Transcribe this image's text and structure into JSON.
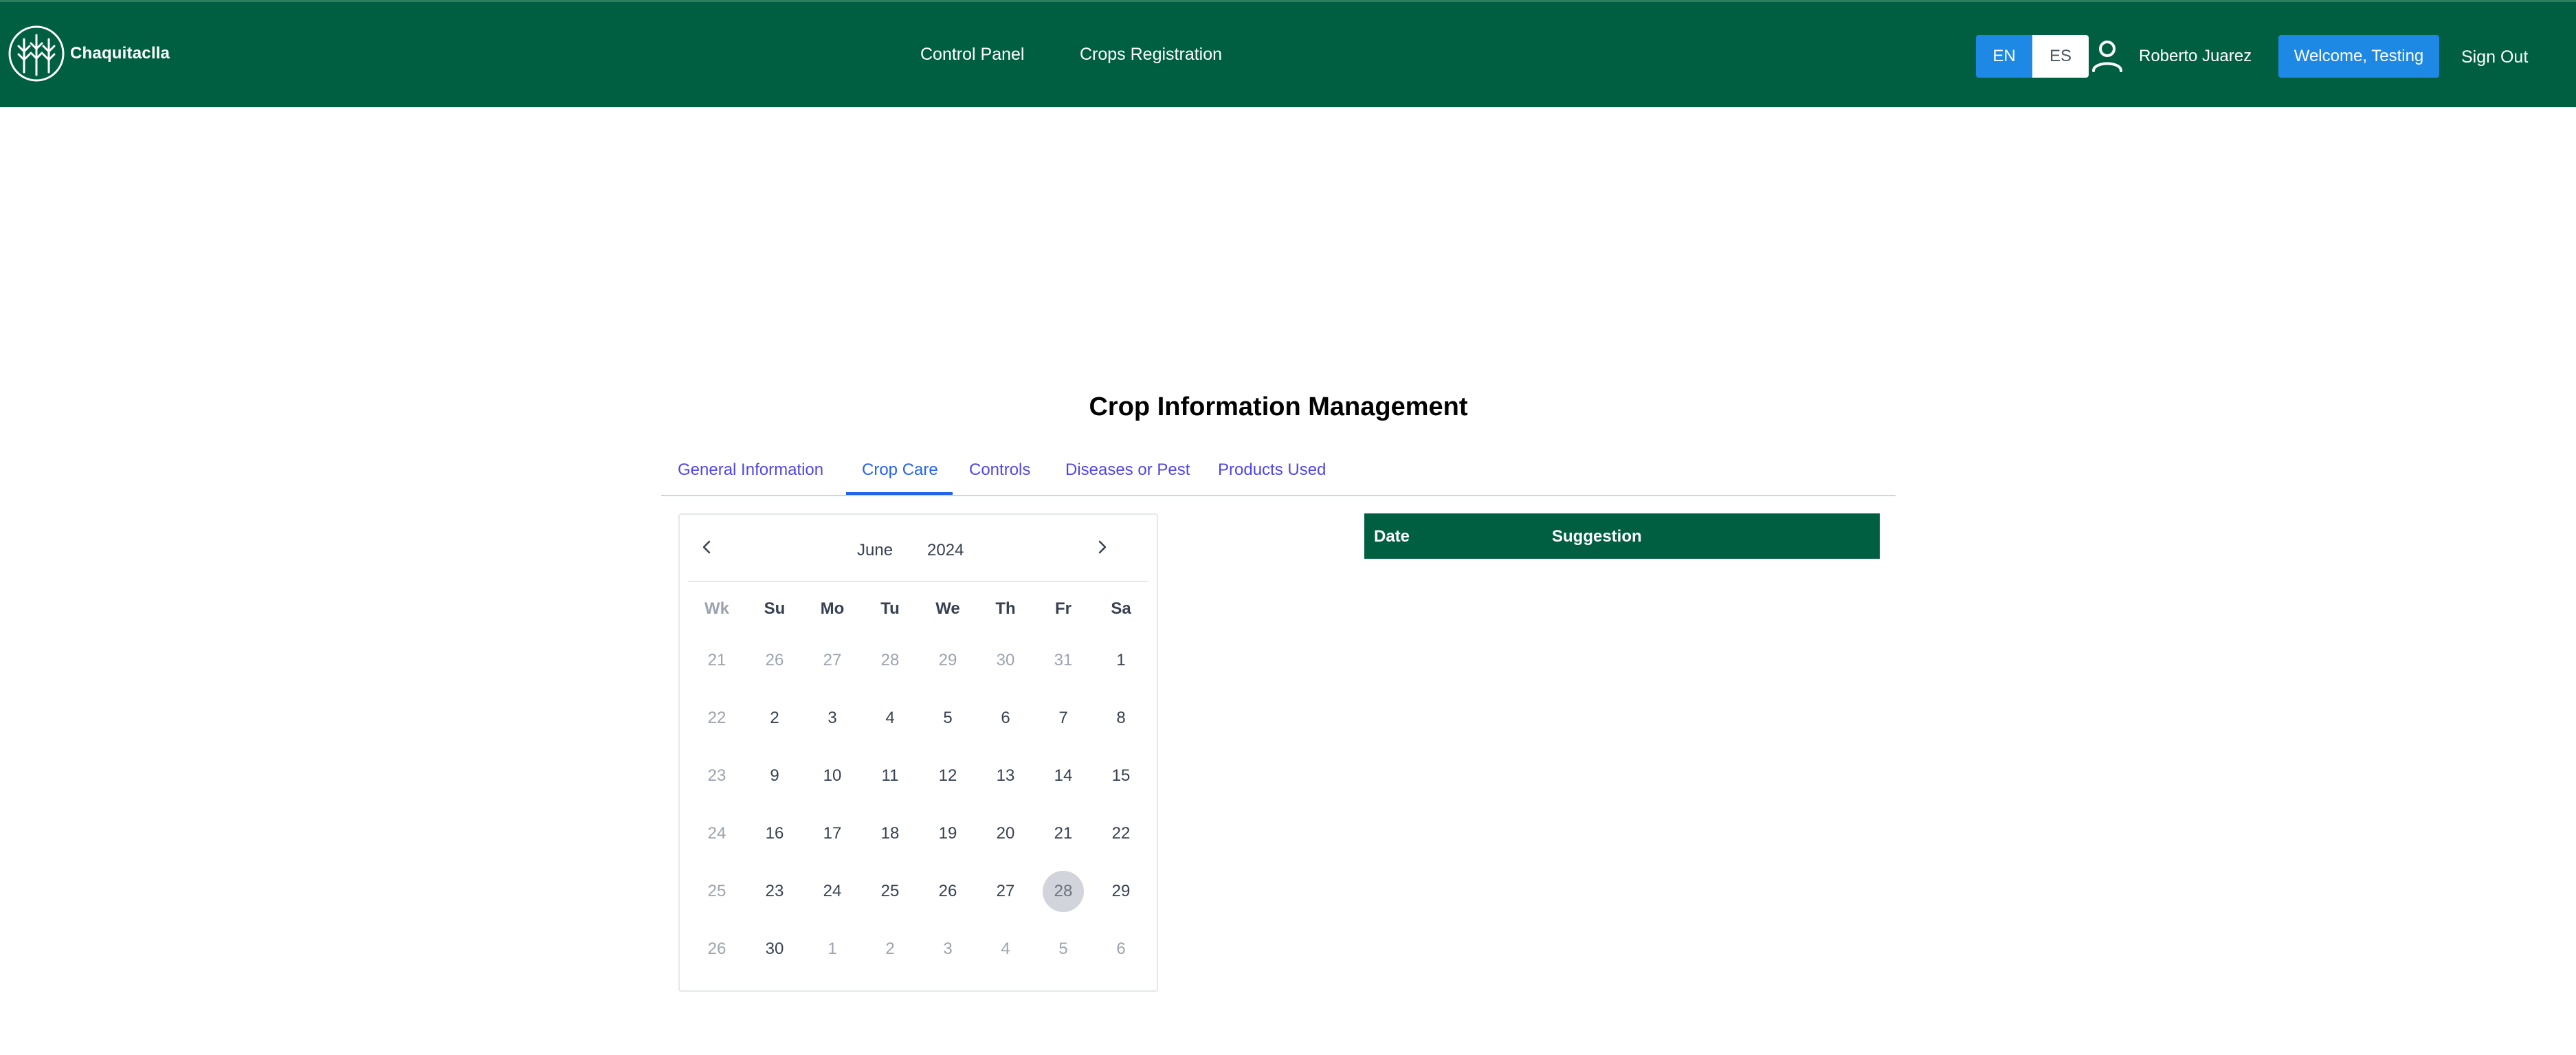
{
  "header": {
    "brand": "Chaquitaclla",
    "logo_icon": "wheat-logo-icon",
    "nav": [
      {
        "label": "Control Panel"
      },
      {
        "label": "Crops Registration"
      }
    ],
    "lang": {
      "en": "EN",
      "es": "ES",
      "selected": "EN"
    },
    "user_icon": "user-icon",
    "user_name": "Roberto Juarez",
    "welcome_label": "Welcome, Testing",
    "signout_label": "Sign Out"
  },
  "page": {
    "title": "Crop Information Management",
    "tabs": [
      {
        "label": "General Information",
        "active": false
      },
      {
        "label": "Crop Care",
        "active": true
      },
      {
        "label": "Controls",
        "active": false
      },
      {
        "label": "Diseases or Pest",
        "active": false
      },
      {
        "label": "Products Used",
        "active": false
      }
    ]
  },
  "calendar": {
    "month": "June",
    "year": "2024",
    "prev_icon": "chevron-left-icon",
    "next_icon": "chevron-right-icon",
    "weekday_headers": [
      "Wk",
      "Su",
      "Mo",
      "Tu",
      "We",
      "Th",
      "Fr",
      "Sa"
    ],
    "selected_day": "28",
    "weeks": [
      {
        "wk": "21",
        "days": [
          "26",
          "27",
          "28",
          "29",
          "30",
          "31",
          "1"
        ],
        "other": [
          true,
          true,
          true,
          true,
          true,
          true,
          false
        ]
      },
      {
        "wk": "22",
        "days": [
          "2",
          "3",
          "4",
          "5",
          "6",
          "7",
          "8"
        ],
        "other": [
          false,
          false,
          false,
          false,
          false,
          false,
          false
        ]
      },
      {
        "wk": "23",
        "days": [
          "9",
          "10",
          "11",
          "12",
          "13",
          "14",
          "15"
        ],
        "other": [
          false,
          false,
          false,
          false,
          false,
          false,
          false
        ]
      },
      {
        "wk": "24",
        "days": [
          "16",
          "17",
          "18",
          "19",
          "20",
          "21",
          "22"
        ],
        "other": [
          false,
          false,
          false,
          false,
          false,
          false,
          false
        ]
      },
      {
        "wk": "25",
        "days": [
          "23",
          "24",
          "25",
          "26",
          "27",
          "28",
          "29"
        ],
        "other": [
          false,
          false,
          false,
          false,
          false,
          false,
          false
        ]
      },
      {
        "wk": "26",
        "days": [
          "30",
          "1",
          "2",
          "3",
          "4",
          "5",
          "6"
        ],
        "other": [
          false,
          true,
          true,
          true,
          true,
          true,
          true
        ]
      }
    ]
  },
  "table": {
    "columns": [
      "Date",
      "Suggestion"
    ],
    "rows": []
  },
  "colors": {
    "header_bg": "#005f41",
    "accent_blue": "#1e88e5",
    "tab_active": "#2563eb"
  }
}
